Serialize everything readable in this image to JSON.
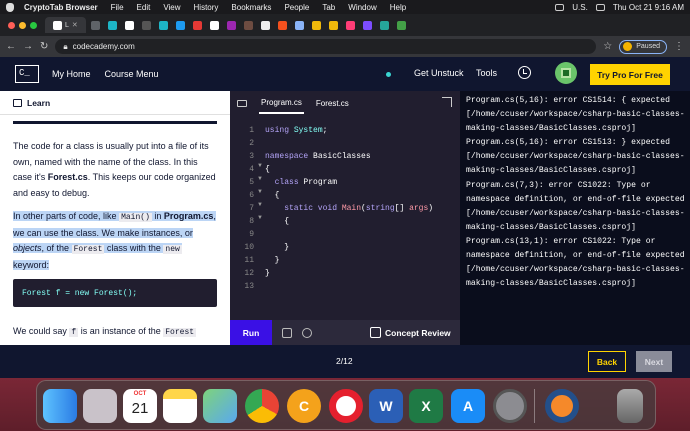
{
  "menubar": {
    "app_name": "CryptoTab Browser",
    "items": [
      "File",
      "Edit",
      "View",
      "History",
      "Bookmarks",
      "People",
      "Tab",
      "Window",
      "Help"
    ],
    "region": "U.S.",
    "clock": "Thu Oct 21  9:16 AM"
  },
  "browser": {
    "active_tab_label": "L",
    "url": "codecademy.com",
    "paused_label": "Paused"
  },
  "header": {
    "logo": "C_",
    "nav": [
      "My Home",
      "Course Menu"
    ],
    "get_unstuck": "Get Unstuck",
    "tools": "Tools",
    "try_pro": "Try Pro For Free"
  },
  "learn": {
    "title": "Learn",
    "p1_a": "The code for a class is usually put into a file of its own, named with the name of the class. In this case it's ",
    "p1_bold": "Forest.cs",
    "p1_b": ". This keeps our code organized and easy to debug.",
    "p2_a": "In other parts of code, like ",
    "p2_code1": "Main()",
    "p2_b": " in ",
    "p2_bold": "Program.cs",
    "p2_c": ", we can use the class. We make instances, or ",
    "p2_em": "objects",
    "p2_d": ", of the ",
    "p2_code2": "Forest",
    "p2_e": " class with the ",
    "p2_code3": "new",
    "p2_f": " keyword:",
    "code_example": "Forest f = new Forest();",
    "p3_a": "We could say ",
    "p3_code1": "f",
    "p3_b": " is an instance of the ",
    "p3_code2": "Forest"
  },
  "editor": {
    "tabs": [
      "Program.cs",
      "Forest.cs"
    ],
    "line_numbers": [
      "1",
      "2",
      "3",
      "4",
      "5",
      "6",
      "7",
      "8",
      "9",
      "10",
      "11",
      "12",
      "13"
    ],
    "run_label": "Run",
    "concept_review": "Concept Review"
  },
  "terminal": {
    "output": "Program.cs(5,16): error CS1514: { expected [/home/ccuser/workspace/csharp-basic-classes-making-classes/BasicClasses.csproj]\nProgram.cs(5,16): error CS1513: } expected [/home/ccuser/workspace/csharp-basic-classes-making-classes/BasicClasses.csproj]\nProgram.cs(7,3): error CS1022: Type or namespace definition, or end-of-file expected [/home/ccuser/workspace/csharp-basic-classes-making-classes/BasicClasses.csproj]\nProgram.cs(13,1): error CS1022: Type or namespace definition, or end-of-file expected [/home/ccuser/workspace/csharp-basic-classes-making-classes/BasicClasses.csproj]"
  },
  "footer": {
    "progress": "2/12",
    "back": "Back",
    "next": "Next"
  },
  "dock": {
    "calendar_month": "OCT",
    "calendar_day": "21"
  }
}
